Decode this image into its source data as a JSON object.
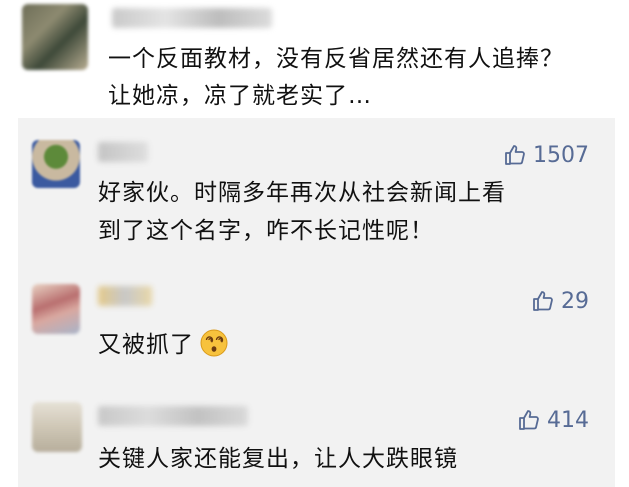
{
  "top_comment": {
    "lines": [
      "一个反面教材，没有反省居然还有人追捧？",
      "让她凉，凉了就老实了…"
    ]
  },
  "replies": [
    {
      "likes": "1507",
      "lines": [
        "好家伙。时隔多年再次从社会新闻上看",
        "到了这个名字，咋不长记性呢！"
      ]
    },
    {
      "likes": "29",
      "lines": [
        "又被抓了"
      ],
      "emoji": "dizzy-face-emoji"
    },
    {
      "likes": "414",
      "lines": [
        "关键人家还能复出，让人大跌眼镜"
      ]
    }
  ],
  "icons": {
    "like": "thumbs-up-icon"
  },
  "colors": {
    "like_text": "#576b95",
    "reply_background": "#f2f2f2",
    "body_text": "#111111"
  }
}
